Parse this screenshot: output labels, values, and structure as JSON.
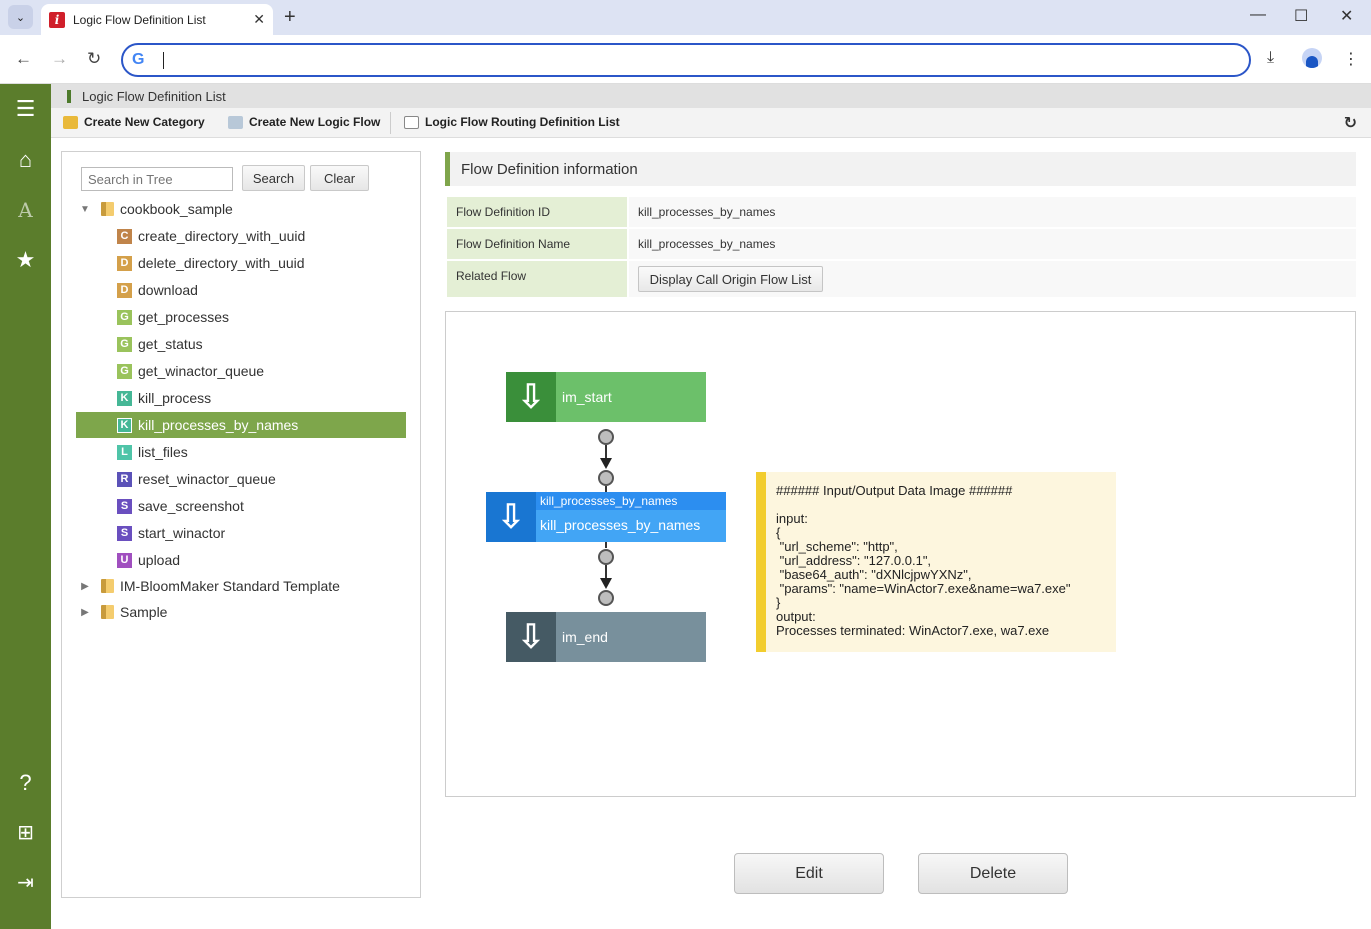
{
  "browser": {
    "tab_title": "Logic Flow Definition List",
    "favicon_letter": "i",
    "close_glyph": "✕",
    "new_tab_glyph": "+",
    "window_controls": [
      "—",
      "☐",
      "✕"
    ],
    "address_value": ""
  },
  "crumb": {
    "title": "Logic Flow Definition List"
  },
  "toolbar": {
    "create_category": "Create New Category",
    "create_flow": "Create New Logic Flow",
    "routing_list": "Logic Flow Routing Definition List"
  },
  "tree": {
    "search_placeholder": "Search in Tree",
    "search_button": "Search",
    "clear_button": "Clear",
    "root_open": {
      "label": "cookbook_sample"
    },
    "items": [
      {
        "letter": "C",
        "label": "create_directory_with_uuid",
        "color": "#c0844a"
      },
      {
        "letter": "D",
        "label": "delete_directory_with_uuid",
        "color": "#d4a04a"
      },
      {
        "letter": "D",
        "label": "download",
        "color": "#d4a04a"
      },
      {
        "letter": "G",
        "label": "get_processes",
        "color": "#9ac35c"
      },
      {
        "letter": "G",
        "label": "get_status",
        "color": "#9ac35c"
      },
      {
        "letter": "G",
        "label": "get_winactor_queue",
        "color": "#9ac35c"
      },
      {
        "letter": "K",
        "label": "kill_process",
        "color": "#45b796"
      },
      {
        "letter": "K",
        "label": "kill_processes_by_names",
        "color": "#45b796",
        "selected": true
      },
      {
        "letter": "L",
        "label": "list_files",
        "color": "#4fc4a8"
      },
      {
        "letter": "R",
        "label": "reset_winactor_queue",
        "color": "#5b52b8"
      },
      {
        "letter": "S",
        "label": "save_screenshot",
        "color": "#6a4fbf"
      },
      {
        "letter": "S",
        "label": "start_winactor",
        "color": "#6a4fbf"
      },
      {
        "letter": "U",
        "label": "upload",
        "color": "#a04fbf"
      }
    ],
    "collapsed": [
      {
        "label": "IM-BloomMaker Standard Template"
      },
      {
        "label": "Sample"
      }
    ]
  },
  "detail": {
    "section_title": "Flow Definition information",
    "rows": [
      {
        "label": "Flow Definition ID",
        "value": "kill_processes_by_names"
      },
      {
        "label": "Flow Definition Name",
        "value": "kill_processes_by_names"
      },
      {
        "label": "Related Flow",
        "button": "Display Call Origin Flow List"
      }
    ]
  },
  "flow": {
    "start": {
      "label": "im_start",
      "color": "#6cc06a",
      "icon_color": "#3a8f3a"
    },
    "task": {
      "line1": "kill_processes_by_names",
      "line2": "kill_processes_by_names",
      "color": "#42a5f5",
      "icon_color": "#1976d2"
    },
    "end": {
      "label": "im_end",
      "color": "#78909c",
      "icon_color": "#455a64"
    },
    "note": "###### Input/Output Data Image ######\n\ninput:\n{\n \"url_scheme\": \"http\",\n \"url_address\": \"127.0.0.1\",\n \"base64_auth\": \"dXNlcjpwYXNz\",\n \"params\": \"name=WinActor7.exe&name=wa7.exe\"\n}\noutput:\nProcesses terminated: WinActor7.exe, wa7.exe"
  },
  "actions": {
    "edit": "Edit",
    "delete": "Delete"
  },
  "colors": {
    "accent": "#5b7d2c",
    "selected": "#7ea64b"
  }
}
